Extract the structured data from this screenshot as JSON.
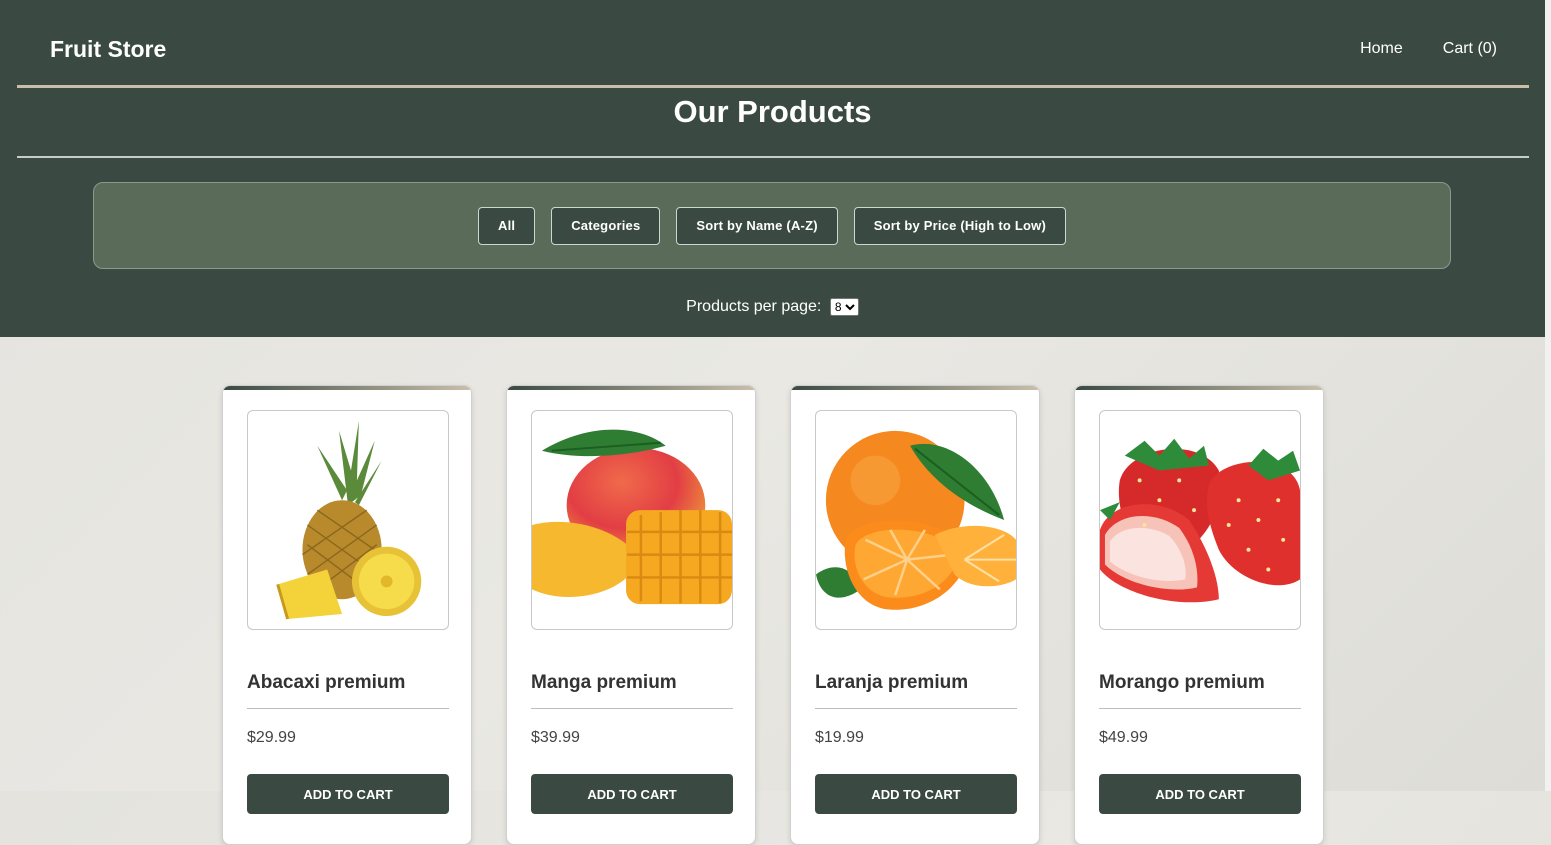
{
  "header": {
    "brand": "Fruit Store",
    "nav": {
      "home": "Home",
      "cart": "Cart (0)"
    }
  },
  "page": {
    "title": "Our Products"
  },
  "filters": {
    "all": "All",
    "categories": "Categories",
    "sort_name": "Sort by Name (A-Z)",
    "sort_price": "Sort by Price (High to Low)"
  },
  "pagination": {
    "label": "Products per page:",
    "selected": "8"
  },
  "products": [
    {
      "name": "Abacaxi premium",
      "price": "$29.99",
      "image_icon": "pineapple-image",
      "button": "ADD TO CART"
    },
    {
      "name": "Manga premium",
      "price": "$39.99",
      "image_icon": "mango-image",
      "button": "ADD TO CART"
    },
    {
      "name": "Laranja premium",
      "price": "$19.99",
      "image_icon": "orange-image",
      "button": "ADD TO CART"
    },
    {
      "name": "Morango premium",
      "price": "$49.99",
      "image_icon": "strawberry-image",
      "button": "ADD TO CART"
    }
  ],
  "colors": {
    "primary": "#3a4a43",
    "filter_bg": "#5a6b5a",
    "accent": "#c9bfa9"
  }
}
